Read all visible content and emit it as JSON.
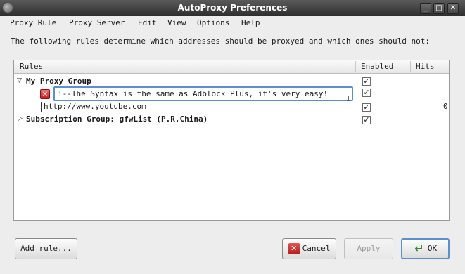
{
  "window": {
    "title": "AutoProxy Preferences"
  },
  "menu": [
    {
      "label": "Proxy Rule"
    },
    {
      "label": "Proxy Server"
    },
    {
      "label": "Edit"
    },
    {
      "label": "View"
    },
    {
      "label": "Options"
    },
    {
      "label": "Help"
    }
  ],
  "description": "The following rules determine which addresses should be proxyed and which ones should not:",
  "table": {
    "columns": {
      "rules": "Rules",
      "enabled": "Enabled",
      "hits": "Hits"
    },
    "rows": [
      {
        "label": "My Proxy Group",
        "type": "group",
        "expanded": true,
        "enabled": true
      },
      {
        "label": "!--The Syntax is the same as Adblock Plus, it's very easy!",
        "type": "editing",
        "enabled": true
      },
      {
        "label": "http://www.youtube.com",
        "type": "rule",
        "enabled": true,
        "hits": "0"
      },
      {
        "label": "Subscription Group: gfwList (P.R.China)",
        "type": "group",
        "expanded": false,
        "enabled": true
      }
    ]
  },
  "buttons": {
    "add_rule": "Add rule...",
    "cancel": "Cancel",
    "apply": "Apply",
    "ok": "OK"
  },
  "icons": {
    "app": "app-icon",
    "minimize": "minimize-icon",
    "maximize": "maximize-icon",
    "close": "close-icon",
    "error": "error-icon",
    "cancel": "cancel-icon",
    "ok": "ok-arrow-icon"
  },
  "colors": {
    "focus": "#5b8fcf",
    "error": "#c81d1d",
    "ok": "#2e8b2e"
  }
}
